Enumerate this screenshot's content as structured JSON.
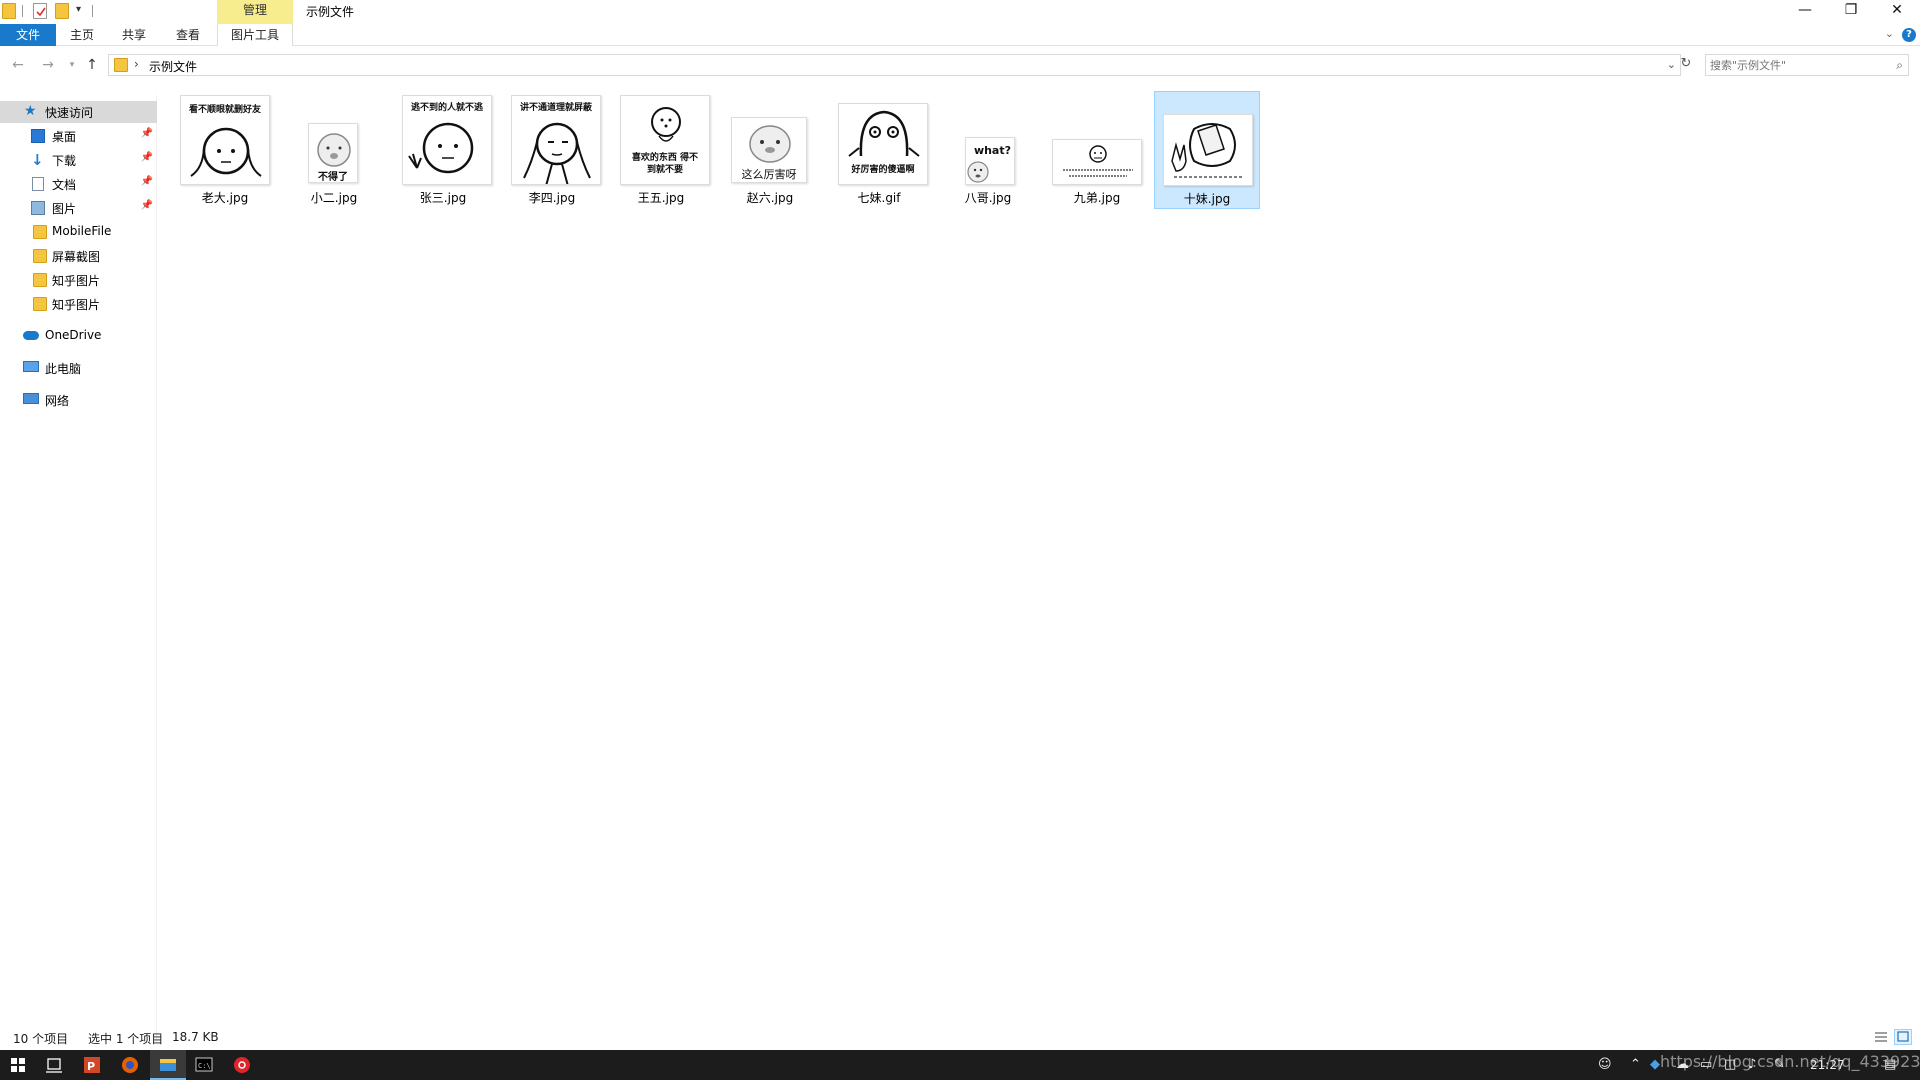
{
  "window": {
    "title": "示例文件",
    "contextual_tab": "管理",
    "controls": {
      "minimize": "—",
      "restore": "❐",
      "close": "✕"
    }
  },
  "ribbon": {
    "tabs": [
      "文件",
      "主页",
      "共享",
      "查看",
      "图片工具"
    ],
    "help": "?"
  },
  "address": {
    "path": "示例文件",
    "search_placeholder": "搜索\"示例文件\""
  },
  "sidebar": {
    "items": [
      {
        "label": "快速访问",
        "icon": "star-icon"
      },
      {
        "label": "桌面",
        "icon": "desktop-icon",
        "pinned": true
      },
      {
        "label": "下载",
        "icon": "download-icon",
        "pinned": true
      },
      {
        "label": "文档",
        "icon": "document-icon",
        "pinned": true
      },
      {
        "label": "图片",
        "icon": "pictures-icon",
        "pinned": true
      },
      {
        "label": "MobileFile",
        "icon": "folder-icon"
      },
      {
        "label": "屏幕截图",
        "icon": "folder-icon"
      },
      {
        "label": "知乎图片",
        "icon": "folder-icon"
      },
      {
        "label": "知乎图片",
        "icon": "folder-icon"
      },
      {
        "label": "OneDrive",
        "icon": "cloud-icon"
      },
      {
        "label": "此电脑",
        "icon": "computer-icon"
      },
      {
        "label": "网络",
        "icon": "network-icon"
      }
    ]
  },
  "files": [
    {
      "name": "老大.jpg",
      "caption": "看不顺眼就删好友"
    },
    {
      "name": "小二.jpg",
      "caption": "不得了"
    },
    {
      "name": "张三.jpg",
      "caption": "逃不到的人就不逃"
    },
    {
      "name": "李四.jpg",
      "caption": "讲不通道理就屏蔽"
    },
    {
      "name": "王五.jpg",
      "caption": "喜欢的东西 得不到就不要"
    },
    {
      "name": "赵六.jpg",
      "caption": "这么厉害呀"
    },
    {
      "name": "七妹.gif",
      "caption": "好厉害的傻逼啊"
    },
    {
      "name": "八哥.jpg",
      "caption": "what?"
    },
    {
      "name": "九弟.jpg",
      "caption": ""
    },
    {
      "name": "十妹.jpg",
      "caption": ""
    }
  ],
  "selected_file": "十妹.jpg",
  "status": {
    "count": "10 个项目",
    "selection": "选中 1 个项目",
    "size": "18.7 KB"
  },
  "taskbar": {
    "watermark": "https://blog.csdn.net/qq_43392365",
    "time": "21:27"
  }
}
